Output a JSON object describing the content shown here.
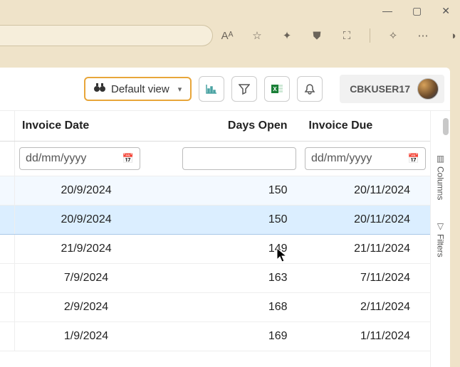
{
  "window": {
    "minimize": "—",
    "maximize": "▢",
    "close": "✕"
  },
  "browser": {
    "icons": [
      "Aᴬ",
      "☆",
      "✦",
      "⛊",
      "⛶",
      "✧",
      "⋯",
      "◑"
    ]
  },
  "toolbar": {
    "view_label": "Default view",
    "user": "CBKUSER17"
  },
  "table": {
    "headers": {
      "invoice_date": "Invoice Date",
      "days_open": "Days Open",
      "invoice_due": "Invoice Due"
    },
    "filters": {
      "date_placeholder": "dd/mm/yyyy"
    },
    "rows": [
      {
        "invoice_date": "20/9/2024",
        "days_open": "150",
        "invoice_due": "20/11/2024",
        "state": "hover"
      },
      {
        "invoice_date": "20/9/2024",
        "days_open": "150",
        "invoice_due": "20/11/2024",
        "state": "selected"
      },
      {
        "invoice_date": "21/9/2024",
        "days_open": "149",
        "invoice_due": "21/11/2024",
        "state": ""
      },
      {
        "invoice_date": "7/9/2024",
        "days_open": "163",
        "invoice_due": "7/11/2024",
        "state": ""
      },
      {
        "invoice_date": "2/9/2024",
        "days_open": "168",
        "invoice_due": "2/11/2024",
        "state": ""
      },
      {
        "invoice_date": "1/9/2024",
        "days_open": "169",
        "invoice_due": "1/11/2024",
        "state": ""
      }
    ]
  },
  "sidebar": {
    "columns": "Columns",
    "filters": "Filters"
  }
}
